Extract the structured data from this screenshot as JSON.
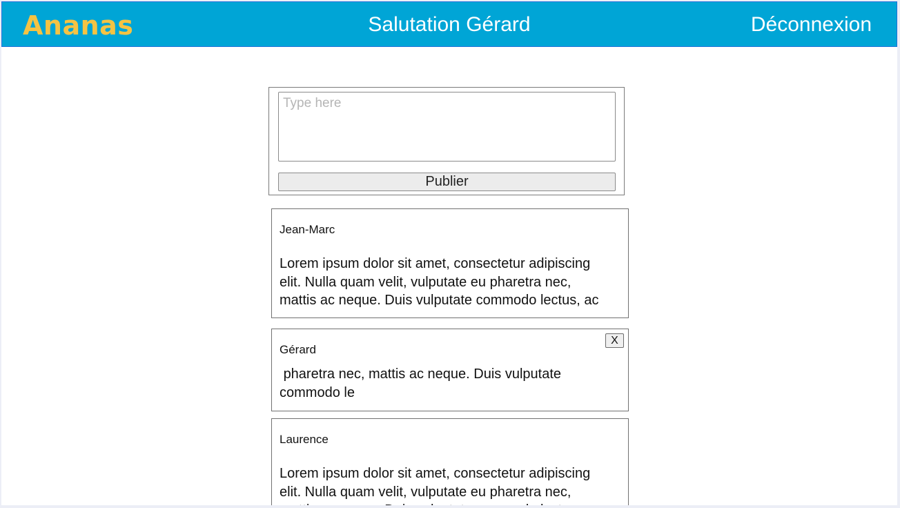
{
  "header": {
    "logo": "Ananas",
    "greeting": "Salutation Gérard",
    "logout": "Déconnexion"
  },
  "composer": {
    "placeholder": "Type here",
    "publish_label": "Publier"
  },
  "posts": [
    {
      "author": "Jean-Marc",
      "body": "Lorem ipsum dolor sit amet, consectetur adipiscing elit. Nulla quam velit, vulputate eu pharetra nec, mattis ac neque. Duis vulputate commodo lectus, ac"
    },
    {
      "author": "Gérard",
      "body": " pharetra nec, mattis ac neque. Duis vulputate commodo le",
      "delete_label": "X"
    },
    {
      "author": "Laurence",
      "body": "Lorem ipsum dolor sit amet, consectetur adipiscing elit. Nulla quam velit, vulputate eu pharetra nec, mattis ac neque. Duis vulputate commodo lectus, ac"
    }
  ]
}
